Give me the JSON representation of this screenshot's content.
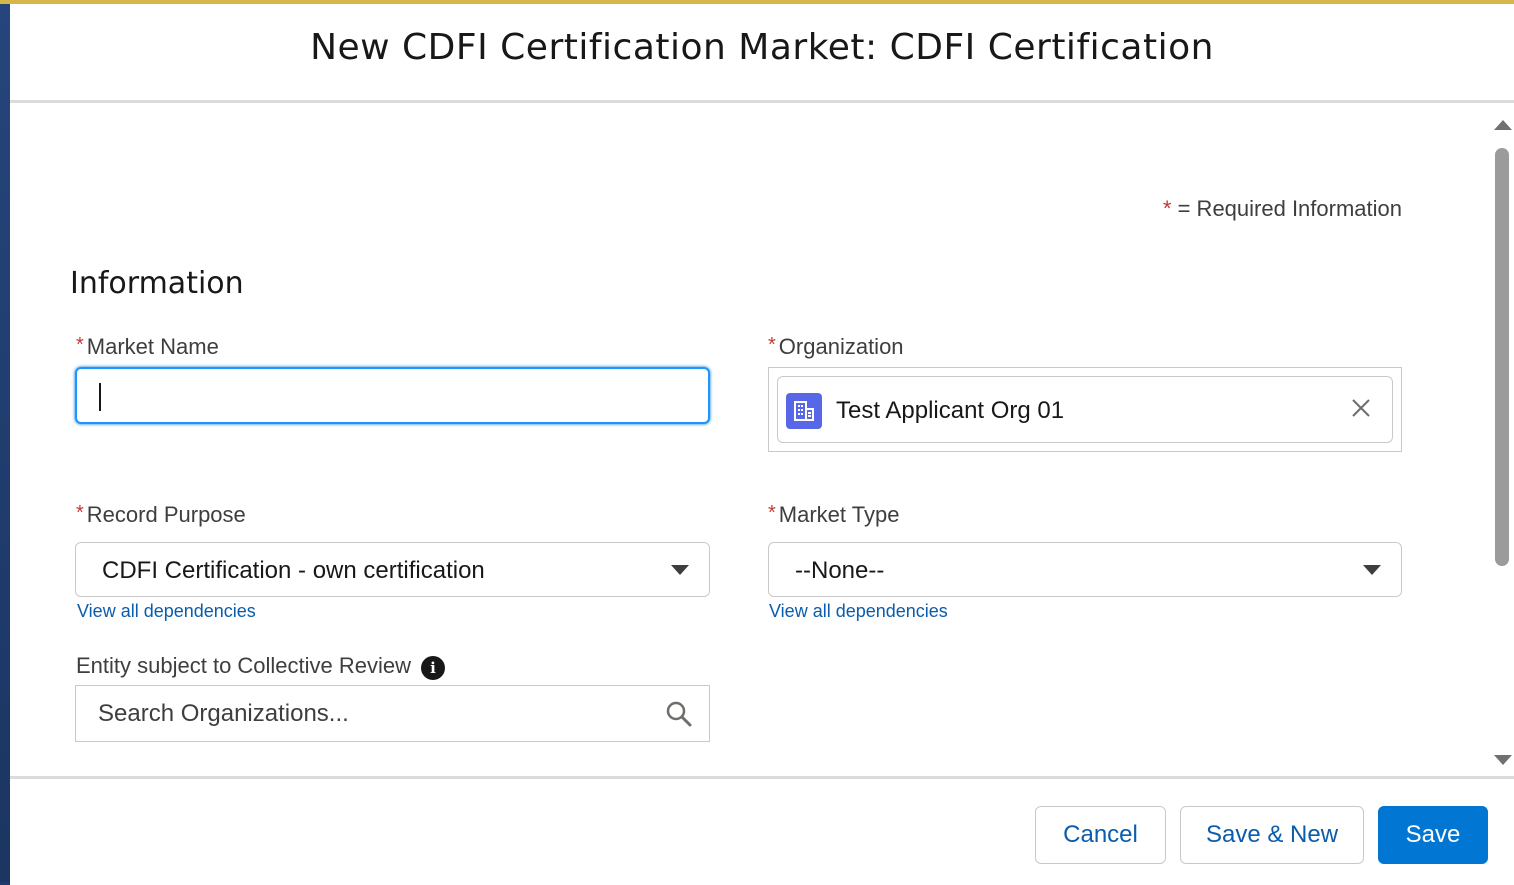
{
  "modal": {
    "title": "New CDFI Certification Market: CDFI Certification"
  },
  "required_info": {
    "star": "*",
    "text": "= Required Information"
  },
  "section": {
    "title": "Information"
  },
  "fields": {
    "market_name": {
      "label": "Market Name",
      "required": "*",
      "value": ""
    },
    "organization": {
      "label": "Organization",
      "required": "*",
      "value": "Test Applicant Org 01",
      "icon": "building-icon",
      "clear_icon": "close-icon"
    },
    "record_purpose": {
      "label": "Record Purpose",
      "required": "*",
      "value": "CDFI Certification - own certification",
      "dependencies_link": "View all dependencies"
    },
    "market_type": {
      "label": "Market Type",
      "required": "*",
      "value": "--None--",
      "dependencies_link": "View all dependencies"
    },
    "collective_review": {
      "label": "Entity subject to Collective Review",
      "info_icon": "i",
      "placeholder": "Search Organizations..."
    }
  },
  "footer": {
    "cancel_label": "Cancel",
    "save_new_label": "Save & New",
    "save_label": "Save"
  },
  "colors": {
    "brand": "#0176d3",
    "link": "#0b5cab",
    "required": "#c23934",
    "focus": "#1b96ff",
    "org_icon": "#5867e8"
  }
}
